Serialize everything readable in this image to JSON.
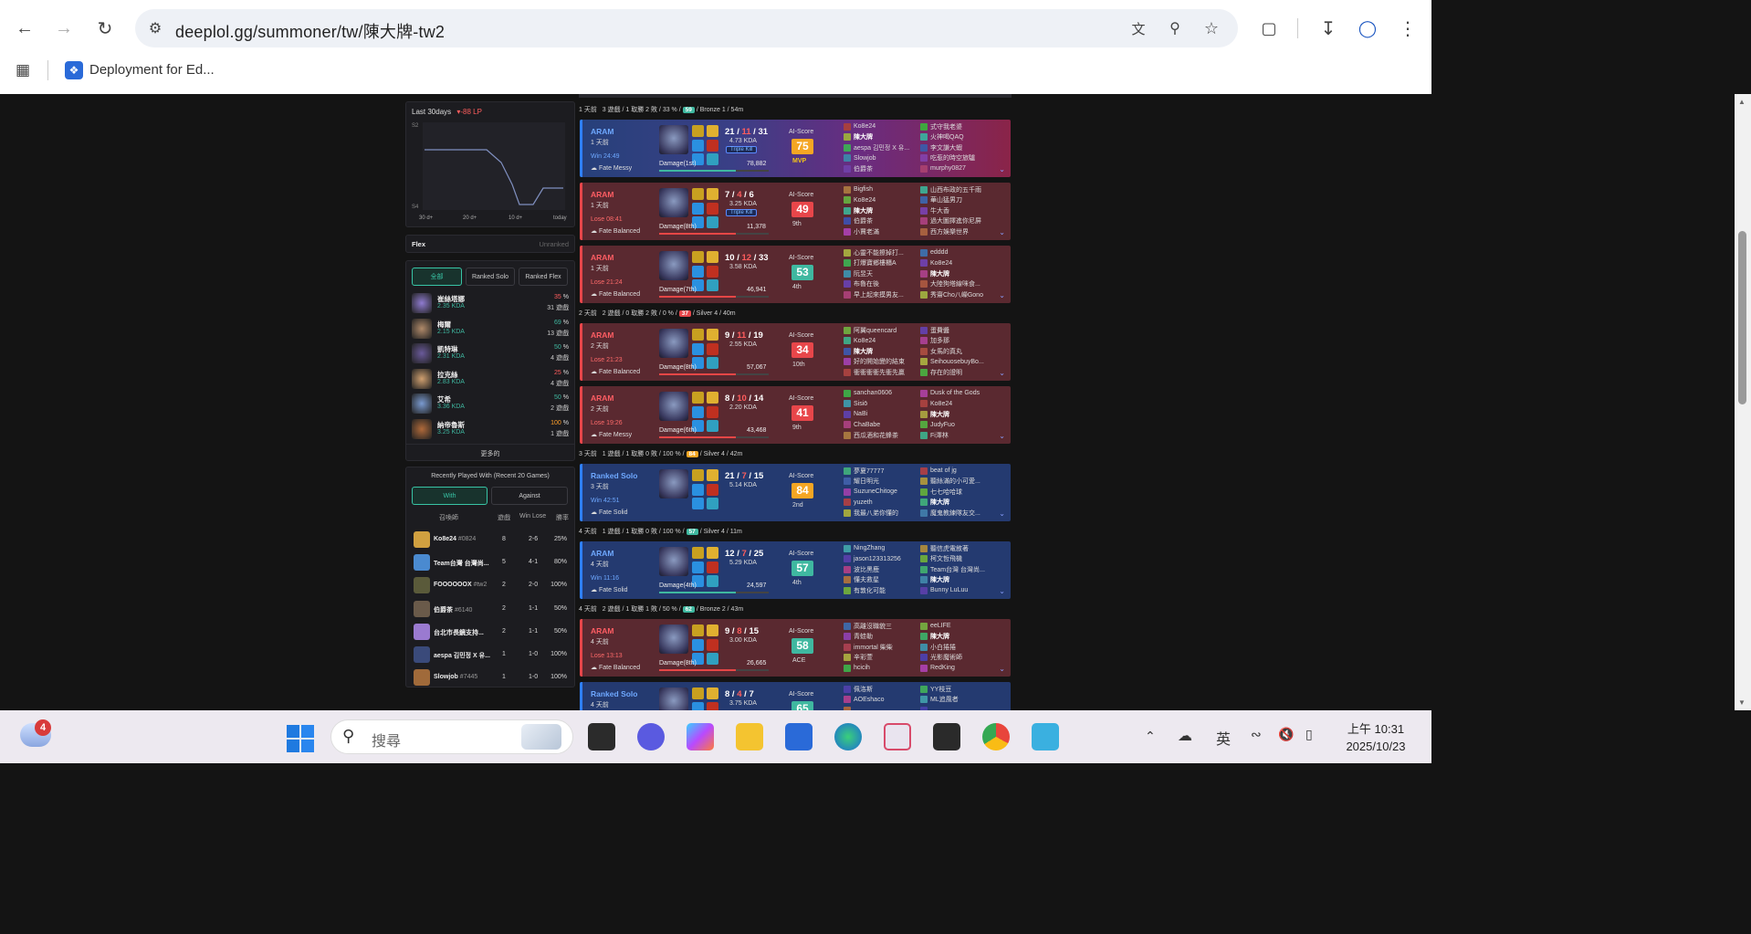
{
  "browser": {
    "url": "deeplol.gg/summoner/tw/陳大牌-tw2",
    "bookmark": "Deployment for Ed..."
  },
  "lp": {
    "title": "Last 30days",
    "delta": "-88 LP",
    "y_top": "S2",
    "y_bottom": "S4",
    "x_labels": [
      "30 d+",
      "20 d+",
      "10 d+",
      "today"
    ]
  },
  "flex": {
    "label": "Flex",
    "value": "Unranked"
  },
  "champ_tabs": [
    "全部",
    "Ranked Solo",
    "Ranked Flex"
  ],
  "champions": [
    {
      "name": "崔絲塔娜",
      "kda": "2.35 KDA",
      "wr": "35",
      "games": "31 遊戲",
      "wr_color": "#ff5d5d",
      "av": "#8f7bd0"
    },
    {
      "name": "梅爾",
      "kda": "2.15 KDA",
      "wr": "69",
      "games": "13 遊戲",
      "wr_color": "#3fb8a0",
      "av": "#b08a6a"
    },
    {
      "name": "凱特琳",
      "kda": "2.31 KDA",
      "wr": "50",
      "games": "4 遊戲",
      "wr_color": "#3fb8a0",
      "av": "#6a5a9a"
    },
    {
      "name": "拉克絲",
      "kda": "2.83 KDA",
      "wr": "25",
      "games": "4 遊戲",
      "wr_color": "#ff5d5d",
      "av": "#d0a070"
    },
    {
      "name": "艾希",
      "kda": "3.36 KDA",
      "wr": "50",
      "games": "2 遊戲",
      "wr_color": "#3fb8a0",
      "av": "#7a9ad0"
    },
    {
      "name": "納帝魯斯",
      "kda": "3.25 KDA",
      "wr": "100",
      "games": "1 遊戲",
      "wr_color": "#ff9f2a",
      "av": "#b06a3a"
    }
  ],
  "more": "更多的",
  "recent": {
    "title": "Recently Played With (Recent 20 Games)",
    "tabs": [
      "With",
      "Against"
    ],
    "headers": [
      "召喚師",
      "遊戲",
      "Win Lose",
      "勝率"
    ],
    "rows": [
      {
        "name": "Ko8e24",
        "tag": "#0824",
        "games": "8",
        "wl": "2-6",
        "wr": "25%",
        "av": "#d0a040"
      },
      {
        "name": "Team台灣 台灣尚...",
        "tag": "",
        "games": "5",
        "wl": "4-1",
        "wr": "80%",
        "av": "#4a8ad0"
      },
      {
        "name": "FOOOOOOX",
        "tag": "#tw2",
        "games": "2",
        "wl": "2-0",
        "wr": "100%",
        "av": "#5a5a3a"
      },
      {
        "name": "伯爵茶",
        "tag": "#6140",
        "games": "2",
        "wl": "1-1",
        "wr": "50%",
        "av": "#6a5a4a"
      },
      {
        "name": "台北市長鏡支持...",
        "tag": "",
        "games": "2",
        "wl": "1-1",
        "wr": "50%",
        "av": "#9a7ad0"
      },
      {
        "name": "aespa 김민정 X 유...",
        "tag": "",
        "games": "1",
        "wl": "1-0",
        "wr": "100%",
        "av": "#3a4a7a"
      },
      {
        "name": "Slowjob",
        "tag": "#7445",
        "games": "1",
        "wl": "1-0",
        "wr": "100%",
        "av": "#a06a3a"
      }
    ]
  },
  "days": [
    {
      "text_a": "1 天前",
      "text_b": "3 遊戲 / 1 取勝 2 敗 / 33 % /",
      "badge": "59",
      "badge_color": "#3fb8a0",
      "text_c": "/ Bronze 1 / 54m"
    },
    {
      "text_a": "2 天前",
      "text_b": "2 遊戲 / 0 取勝 2 敗 / 0 % /",
      "badge": "37",
      "badge_color": "#e8464a",
      "text_c": "/ Silver 4 / 40m"
    },
    {
      "text_a": "3 天前",
      "text_b": "1 遊戲 / 1 取勝 0 敗 / 100 % /",
      "badge": "84",
      "badge_color": "#f5a623",
      "text_c": "/ Silver 4 / 42m"
    },
    {
      "text_a": "4 天前",
      "text_b": "1 遊戲 / 1 取勝 0 敗 / 100 % /",
      "badge": "57",
      "badge_color": "#3fb8a0",
      "text_c": "/ Silver 4 / 11m"
    },
    {
      "text_a": "4 天前",
      "text_b": "2 遊戲 / 1 取勝 1 敗 / 50 % /",
      "badge": "62",
      "badge_color": "#3fb8a0",
      "text_c": "/ Bronze 2 / 43m"
    }
  ],
  "matches": [
    {
      "mode": "ARAM",
      "ago": "1 天前",
      "res": "Win 24:49",
      "fate": "Fate Messy",
      "k": "21",
      "d": "11",
      "a": "31",
      "kda": "4.73 KDA",
      "badge": "Triple Kill",
      "dmg": "Damage(1st)",
      "dmgv": "78,882",
      "score": "75",
      "score_color": "#f5a623",
      "rank": "MVP",
      "team1": [
        "Ko8e24",
        "陳大牌",
        "aespa 김민정 X 유...",
        "Slowjob",
        "伯爵茶"
      ],
      "team2": [
        "式守我老婆",
        "火神喝QAQ",
        "李文謙大蝦",
        "吃惹的時空旅驢",
        "murphy0827"
      ]
    },
    {
      "mode": "ARAM",
      "ago": "1 天前",
      "res": "Lose 08:41",
      "fate": "Fate Balanced",
      "k": "7",
      "d": "4",
      "a": "6",
      "kda": "3.25 KDA",
      "badge": "Triple Kill",
      "dmg": "Damage(8th)",
      "dmgv": "11,378",
      "score": "49",
      "score_color": "#e8464a",
      "rank": "9th",
      "team1": [
        "Bigfish",
        "Ko8e24",
        "陳大牌",
        "伯爵茶",
        "小賈老滿"
      ],
      "team2": [
        "山西布政的五千雨",
        "華山猛男刀",
        "牛大香",
        "過大圖擇進你尼屏",
        "西方娛樂世界"
      ]
    },
    {
      "mode": "ARAM",
      "ago": "1 天前",
      "res": "Lose 21:24",
      "fate": "Fate Balanced",
      "k": "10",
      "d": "12",
      "a": "33",
      "kda": "3.58 KDA",
      "badge": "",
      "dmg": "Damage(7th)",
      "dmgv": "46,941",
      "score": "53",
      "score_color": "#3fb8a0",
      "rank": "4th",
      "team1": [
        "心靈不能擦掉打...",
        "打爆寶鄉樓櫃A",
        "阮昱天",
        "布魯在後",
        "早上起來摸男友..."
      ],
      "team2": [
        "edddd",
        "Ko8e24",
        "陳大牌",
        "大陸狗塔線咪食...",
        "秀齋Cho八嶸Gono"
      ]
    },
    {
      "mode": "ARAM",
      "ago": "2 天前",
      "res": "Lose 21:23",
      "fate": "Fate Balanced",
      "k": "9",
      "d": "11",
      "a": "19",
      "kda": "2.55 KDA",
      "badge": "",
      "dmg": "Damage(8th)",
      "dmgv": "57,067",
      "score": "34",
      "score_color": "#e8464a",
      "rank": "10th",
      "team1": [
        "阿翼queencard",
        "Ko8e24",
        "陳大牌",
        "好的開始變的結束",
        "衝衝衝衝先衝先贏"
      ],
      "team2": [
        "蛋費醬",
        "加多那",
        "女馬的真丸",
        "SeihouosebuyBo...",
        "存在的證明"
      ]
    },
    {
      "mode": "ARAM",
      "ago": "2 天前",
      "res": "Lose 19:26",
      "fate": "Fate Messy",
      "k": "8",
      "d": "10",
      "a": "14",
      "kda": "2.20 KDA",
      "badge": "",
      "dmg": "Damage(6th)",
      "dmgv": "43,468",
      "score": "41",
      "score_color": "#e8464a",
      "rank": "9th",
      "team1": [
        "sanchan0606",
        "Sisiō",
        "NaBi",
        "ChaBabe",
        "西瓜酒和花蜂茶"
      ],
      "team2": [
        "Dusk of the Gods",
        "Ko8e24",
        "陳大牌",
        "JudyFuo",
        "Fi澤林"
      ]
    },
    {
      "mode": "Ranked Solo",
      "ago": "3 天前",
      "res": "Win 42:51",
      "fate": "Fate Solid",
      "k": "21",
      "d": "7",
      "a": "15",
      "kda": "5.14 KDA",
      "badge": "",
      "dmg": "",
      "dmgv": "",
      "score": "84",
      "score_color": "#f5a623",
      "rank": "2nd",
      "team1": [
        "夢夏77777",
        "耀日明光",
        "SuzuneChitoge",
        "yuzeth",
        "我最八弟你懂的"
      ],
      "team2": [
        "beat of jg",
        "聽絲滿的小可愛...",
        "七七哈哈球",
        "陳大牌",
        "魔鬼教練隊友交..."
      ]
    },
    {
      "mode": "ARAM",
      "ago": "4 天前",
      "res": "Win 11:16",
      "fate": "Fate Solid",
      "k": "12",
      "d": "7",
      "a": "25",
      "kda": "5.29 KDA",
      "badge": "",
      "dmg": "Damage(4th)",
      "dmgv": "24,597",
      "score": "57",
      "score_color": "#3fb8a0",
      "rank": "4th",
      "team1": [
        "NingZhang",
        "jason123313256",
        "波比黑鹿",
        "懂夫救星",
        "有敦化可能"
      ],
      "team2": [
        "聽信虎電敘著",
        "柯文哲飛機",
        "Team台灣 台灣尚...",
        "陳大牌",
        "Bunny LuLuu"
      ]
    },
    {
      "mode": "ARAM",
      "ago": "4 天前",
      "res": "Lose 13:13",
      "fate": "Fate Balanced",
      "k": "9",
      "d": "8",
      "a": "15",
      "kda": "3.00 KDA",
      "badge": "",
      "dmg": "Damage(8th)",
      "dmgv": "26,665",
      "score": "58",
      "score_color": "#3fb8a0",
      "rank": "ACE",
      "team1": [
        "高離沒職貌三",
        "青蛙勒",
        "immortal 柴柴",
        "辛彩萱",
        "hcicih"
      ],
      "team2": [
        "eeLIFE",
        "陳大牌",
        "小白捲捲",
        "光影魔術師",
        "RedKing"
      ]
    },
    {
      "mode": "Ranked Solo",
      "ago": "4 天前",
      "res": "",
      "fate": "",
      "k": "8",
      "d": "4",
      "a": "7",
      "kda": "3.75 KDA",
      "badge": "",
      "dmg": "",
      "dmgv": "",
      "score": "65",
      "score_color": "#3fb8a0",
      "rank": "",
      "team1": [
        "佩洛斯",
        "AOEshaco",
        "",
        "",
        ""
      ],
      "team2": [
        "YY枝豆",
        "ML追風者",
        "",
        "",
        ""
      ]
    }
  ],
  "taskbar": {
    "search_placeholder": "搜尋",
    "ime": "英",
    "time": "上午 10:31",
    "date": "2025/10/23",
    "weather_badge": "4"
  }
}
